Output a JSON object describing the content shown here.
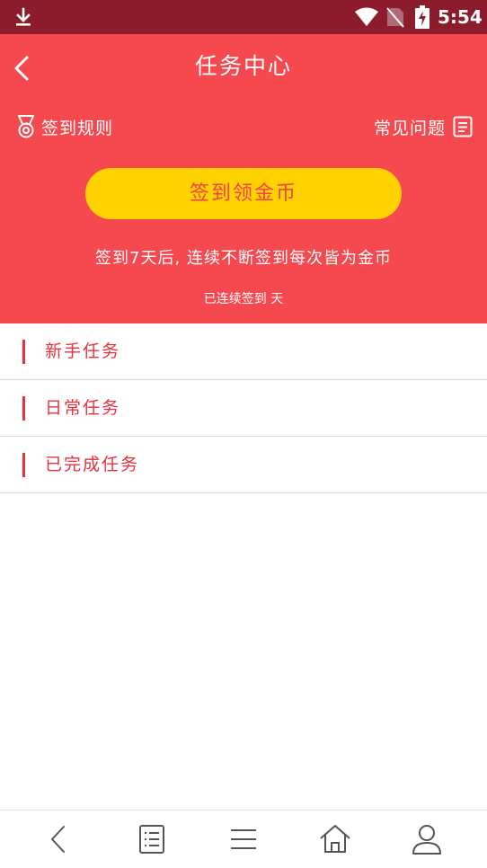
{
  "status_bar": {
    "time": "5:54",
    "icons": [
      "download-icon",
      "wifi-icon",
      "no-sim-icon",
      "battery-charging-icon"
    ]
  },
  "header": {
    "title": "任务中心",
    "rules_label": "签到规则",
    "faq_label": "常见问题",
    "checkin_button": "签到领金币",
    "description": "签到7天后, 连续不断签到每次皆为金币",
    "streak_text": "已连续签到 天"
  },
  "tasks": [
    {
      "label": "新手任务"
    },
    {
      "label": "日常任务"
    },
    {
      "label": "已完成任务"
    }
  ],
  "bottom_nav": {
    "icons": [
      "back-icon",
      "list-icon",
      "menu-icon",
      "home-icon",
      "user-icon"
    ]
  },
  "colors": {
    "status_bar": "#8c1c2c",
    "header_bg": "#f5484f",
    "button_bg": "#ffd200",
    "accent_red": "#e8313d"
  }
}
